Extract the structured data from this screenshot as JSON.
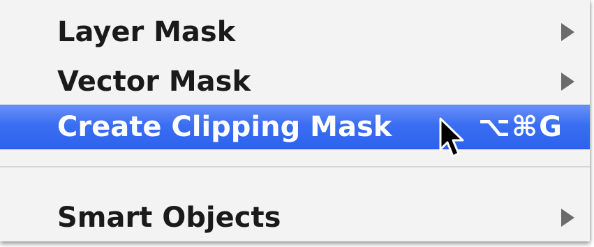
{
  "menu": {
    "items": [
      {
        "label": "Layer Mask",
        "has_submenu": true,
        "highlighted": false
      },
      {
        "label": "Vector Mask",
        "has_submenu": true,
        "highlighted": false
      },
      {
        "label": "Create Clipping Mask",
        "shortcut": "⌥⌘G",
        "has_submenu": false,
        "highlighted": true
      },
      {
        "label": "Smart Objects",
        "has_submenu": true,
        "highlighted": false
      }
    ],
    "colors": {
      "background": "#f3f3f3",
      "highlight": "#3a6ef2",
      "text": "#1a1a1a",
      "highlight_text": "#ffffff",
      "submenu_arrow": "#6b6b6b"
    }
  },
  "cursor": {
    "icon": "arrow-cursor-icon"
  }
}
